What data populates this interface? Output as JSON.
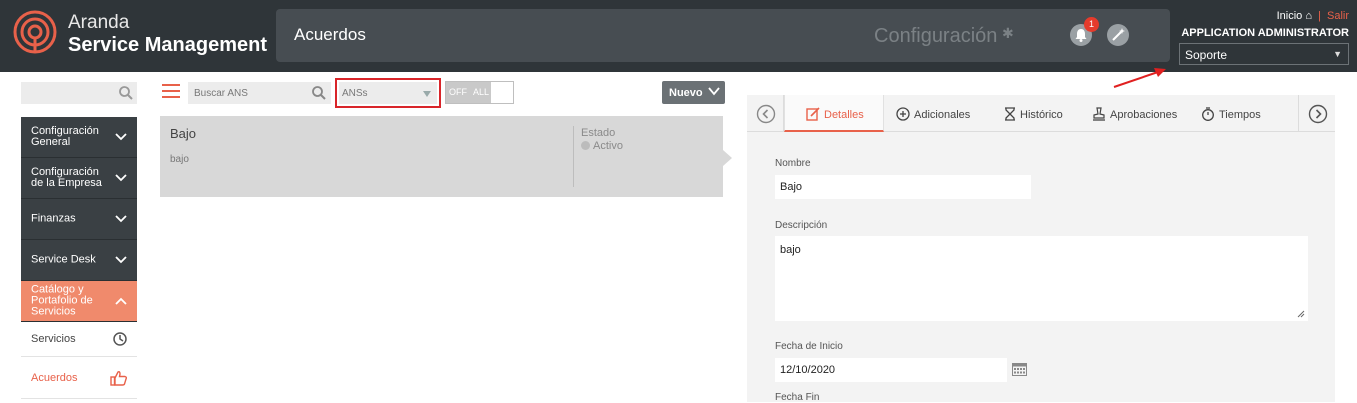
{
  "header": {
    "brand_line1": "Aranda",
    "brand_line2": "Service Management",
    "module_title": "Acuerdos",
    "config_label": "Configuración",
    "notification_count": "1",
    "home_link": "Inicio",
    "logout_link": "Salir",
    "user_name": "APPLICATION ADMINISTRATOR",
    "role_selected": "Soporte"
  },
  "sidebar": {
    "search_placeholder": "",
    "groups": [
      {
        "label": "Configuración General"
      },
      {
        "label": "Configuración de la Empresa"
      },
      {
        "label": "Finanzas"
      },
      {
        "label": "Service Desk"
      },
      {
        "label": "Catálogo y Portafolio de Servicios"
      }
    ],
    "sub_items": [
      {
        "label": "Servicios"
      },
      {
        "label": "Acuerdos"
      }
    ]
  },
  "toolbar": {
    "search_placeholder": "Buscar ANS",
    "filter_value": "ANSs",
    "toggle_off": "OFF",
    "toggle_all": "ALL",
    "new_button": "Nuevo"
  },
  "list": {
    "items": [
      {
        "name": "Bajo",
        "description": "bajo",
        "status_label": "Estado",
        "status_value": "Activo"
      }
    ]
  },
  "detail": {
    "tabs": [
      "Detalles",
      "Adicionales",
      "Histórico",
      "Aprobaciones",
      "Tiempos"
    ],
    "active_tab": "Detalles",
    "fields": {
      "name_label": "Nombre",
      "name_value": "Bajo",
      "description_label": "Descripción",
      "description_value": "bajo",
      "start_date_label": "Fecha de Inicio",
      "start_date_value": "12/10/2020",
      "end_date_label": "Fecha Fin"
    }
  },
  "colors": {
    "header_bg": "#2f3539",
    "accent": "#e8614a",
    "sidebar_active": "#f08a6c",
    "sidebar_bg": "#3a4044",
    "highlight_border": "#d9252a"
  }
}
